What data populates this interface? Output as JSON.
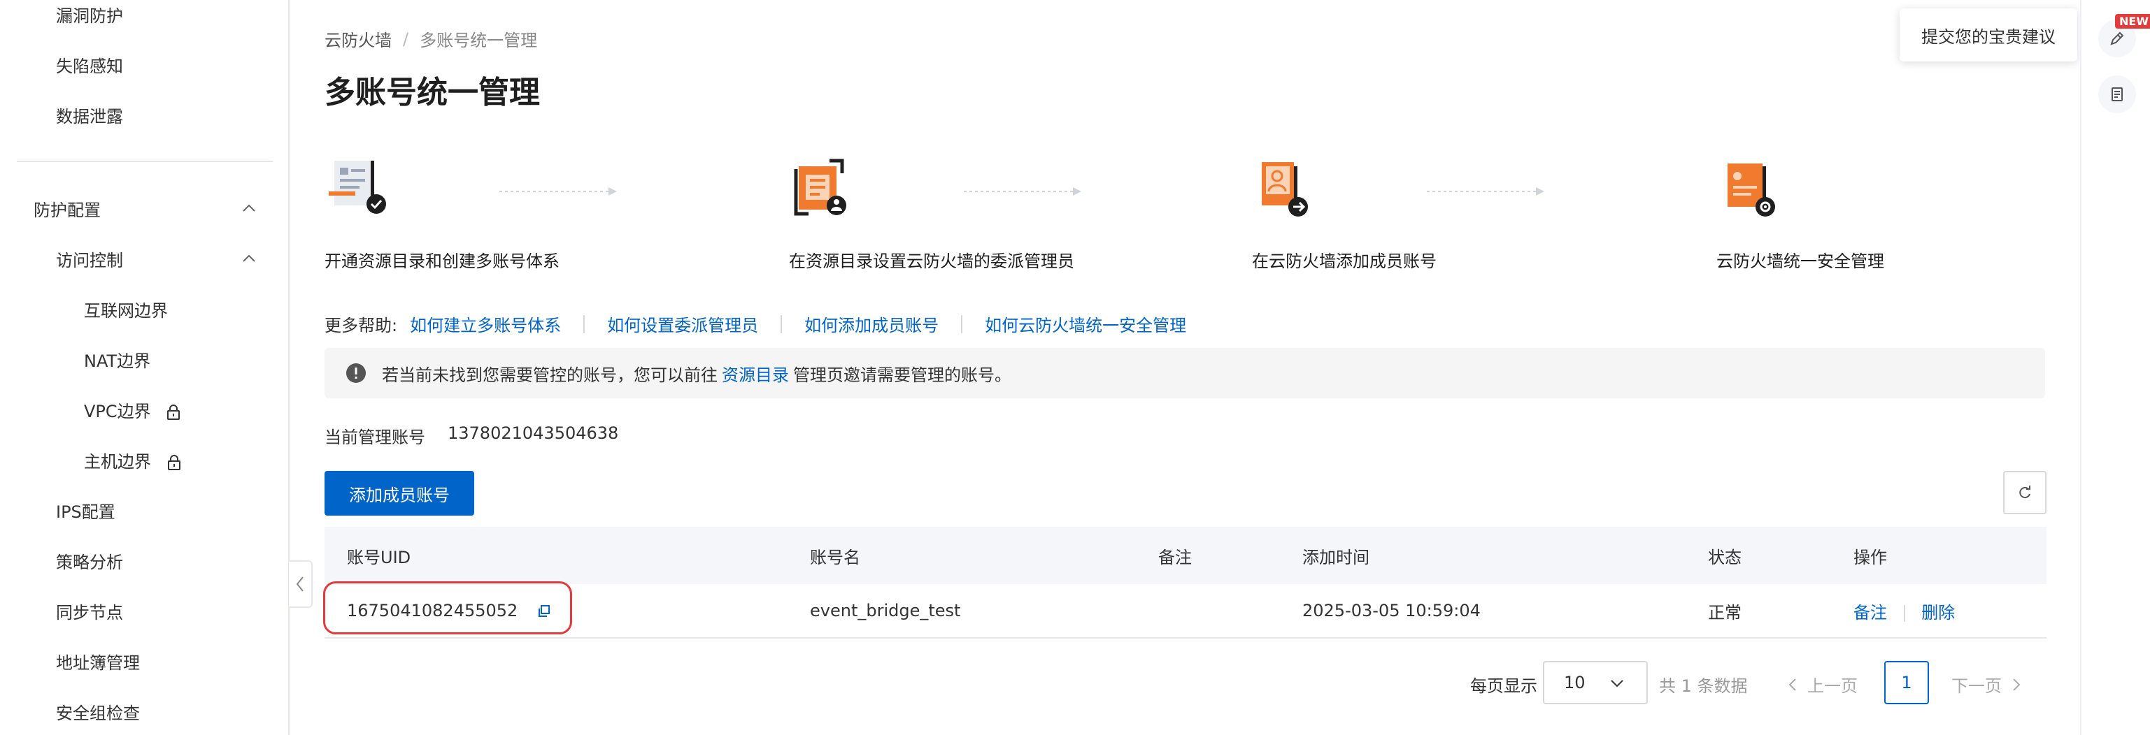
{
  "sidebar": {
    "items": [
      {
        "label": "漏洞防护"
      },
      {
        "label": "失陷感知"
      },
      {
        "label": "数据泄露"
      },
      {
        "label": "防护配置"
      },
      {
        "label": "访问控制"
      },
      {
        "label": "互联网边界"
      },
      {
        "label": "NAT边界"
      },
      {
        "label": "VPC边界"
      },
      {
        "label": "主机边界"
      },
      {
        "label": "IPS配置"
      },
      {
        "label": "策略分析"
      },
      {
        "label": "同步节点"
      },
      {
        "label": "地址簿管理"
      },
      {
        "label": "安全组检查"
      }
    ]
  },
  "breadcrumb": {
    "root": "云防火墙",
    "separator": "/",
    "current": "多账号统一管理"
  },
  "page": {
    "title": "多账号统一管理"
  },
  "steps": [
    {
      "label": "开通资源目录和创建多账号体系",
      "icon": "doc-check-icon"
    },
    {
      "label": "在资源目录设置云防火墙的委派管理员",
      "icon": "delegate-admin-icon"
    },
    {
      "label": "在云防火墙添加成员账号",
      "icon": "add-member-icon"
    },
    {
      "label": "云防火墙统一安全管理",
      "icon": "security-manage-icon"
    }
  ],
  "help": {
    "label": "更多帮助:",
    "links": [
      "如何建立多账号体系",
      "如何设置委派管理员",
      "如何添加成员账号",
      "如何云防火墙统一安全管理"
    ]
  },
  "notice": {
    "before": "若当前未找到您需要管控的账号，您可以前往",
    "link": "资源目录",
    "after": "管理页邀请需要管理的账号。"
  },
  "current_account": {
    "label": "当前管理账号",
    "value": "1378021043504638"
  },
  "actions": {
    "add_member": "添加成员账号"
  },
  "table": {
    "columns": [
      "账号UID",
      "账号名",
      "备注",
      "添加时间",
      "状态",
      "操作"
    ],
    "rows": [
      {
        "uid": "1675041082455052",
        "name": "event_bridge_test",
        "remark": "",
        "added": "2025-03-05 10:59:04",
        "status": "正常",
        "op_remark": "备注",
        "op_delete": "删除"
      }
    ]
  },
  "pagination": {
    "per_page_label": "每页显示",
    "page_size": "10",
    "total": "共 1 条数据",
    "prev": "上一页",
    "next": "下一页",
    "current": "1"
  },
  "rail": {
    "new_badge": "NEW",
    "feedback_tooltip": "提交您的宝贵建议"
  },
  "colors": {
    "primary": "#0064c8",
    "accent_orange": "#f07a2d",
    "highlight_red": "#e23b3b"
  }
}
